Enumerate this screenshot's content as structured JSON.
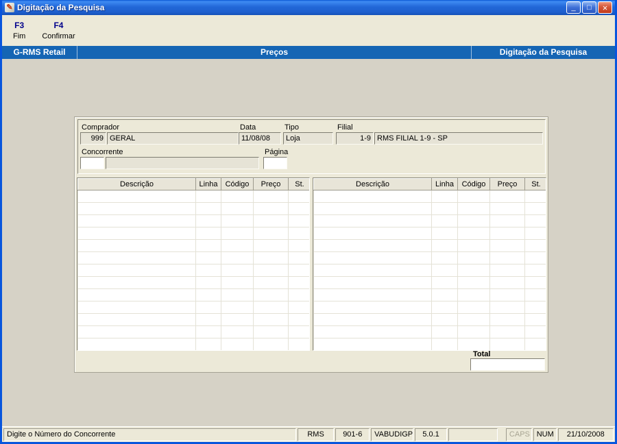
{
  "window": {
    "title": "Digitação da Pesquisa",
    "icon_glyph": "✎",
    "minimize_glyph": "_",
    "maximize_glyph": "□",
    "close_glyph": "×"
  },
  "toolbar": {
    "fim": {
      "key": "F3",
      "label": "Fim"
    },
    "confirmar": {
      "key": "F4",
      "label": "Confirmar"
    }
  },
  "header": {
    "left": "G-RMS Retail",
    "center": "Preços",
    "right": "Digitação da Pesquisa"
  },
  "form": {
    "comprador_label": "Comprador",
    "comprador_code": "999",
    "comprador_name": "GERAL",
    "data_label": "Data",
    "data_value": "11/08/08",
    "tipo_label": "Tipo",
    "tipo_value": "Loja",
    "filial_label": "Filial",
    "filial_code": "1-9",
    "filial_name": "RMS FILIAL 1-9 - SP",
    "concorrente_label": "Concorrente",
    "concorrente_code": "",
    "concorrente_name": "",
    "pagina_label": "Página",
    "pagina_value": ""
  },
  "grid": {
    "columns": [
      "Descrição",
      "Linha",
      "Código",
      "Preço",
      "St."
    ],
    "row_count": 13
  },
  "total": {
    "label": "Total",
    "value": ""
  },
  "statusbar": {
    "message": "Digite o Número do Concorrente",
    "system": "RMS",
    "terminal": "901-6",
    "program": "VABUDIGP",
    "version": "5.0.1",
    "caps": "CAPS",
    "num": "NUM",
    "date": "21/10/2008"
  }
}
